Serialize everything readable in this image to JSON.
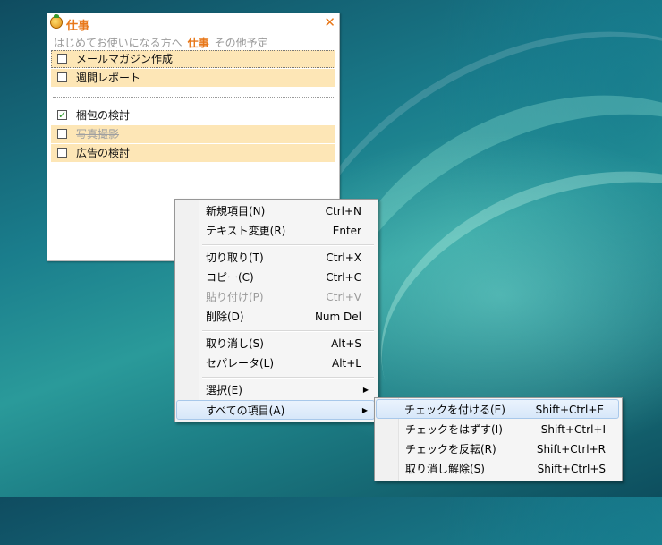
{
  "window": {
    "title": "仕事",
    "close_label": "✕",
    "tabs": [
      {
        "label": "はじめてお使いになる方へ",
        "active": false
      },
      {
        "label": "仕事",
        "active": true
      },
      {
        "label": "その他予定",
        "active": false
      }
    ],
    "tasks": [
      {
        "label": "メールマガジン作成",
        "checked": false,
        "done": false,
        "highlight": true
      },
      {
        "label": "週間レポート",
        "checked": false,
        "done": false,
        "highlight": true
      },
      {
        "label": "梱包の検討",
        "checked": true,
        "done": false,
        "highlight": false
      },
      {
        "label": "写真撮影",
        "checked": false,
        "done": true,
        "highlight": true
      },
      {
        "label": "広告の検討",
        "checked": false,
        "done": false,
        "highlight": true
      }
    ]
  },
  "context_menu": {
    "items": [
      {
        "label": "新規項目(N)",
        "shortcut": "Ctrl+N"
      },
      {
        "label": "テキスト変更(R)",
        "shortcut": "Enter"
      },
      {
        "label": "切り取り(T)",
        "shortcut": "Ctrl+X"
      },
      {
        "label": "コピー(C)",
        "shortcut": "Ctrl+C"
      },
      {
        "label": "貼り付け(P)",
        "shortcut": "Ctrl+V",
        "disabled": true
      },
      {
        "label": "削除(D)",
        "shortcut": "Num Del"
      },
      {
        "label": "取り消し(S)",
        "shortcut": "Alt+S"
      },
      {
        "label": "セパレータ(L)",
        "shortcut": "Alt+L"
      },
      {
        "label": "選択(E)",
        "submenu": true
      },
      {
        "label": "すべての項目(A)",
        "submenu": true,
        "hover": true
      }
    ]
  },
  "submenu": {
    "items": [
      {
        "label": "チェックを付ける(E)",
        "shortcut": "Shift+Ctrl+E",
        "hover": true
      },
      {
        "label": "チェックをはずす(I)",
        "shortcut": "Shift+Ctrl+I"
      },
      {
        "label": "チェックを反転(R)",
        "shortcut": "Shift+Ctrl+R"
      },
      {
        "label": "取り消し解除(S)",
        "shortcut": "Shift+Ctrl+S"
      }
    ]
  },
  "colors": {
    "accent": "#e8781a",
    "task_highlight": "#fde6b6",
    "check": "#2b9a2b",
    "menu_hover": "#d7e7f9"
  }
}
